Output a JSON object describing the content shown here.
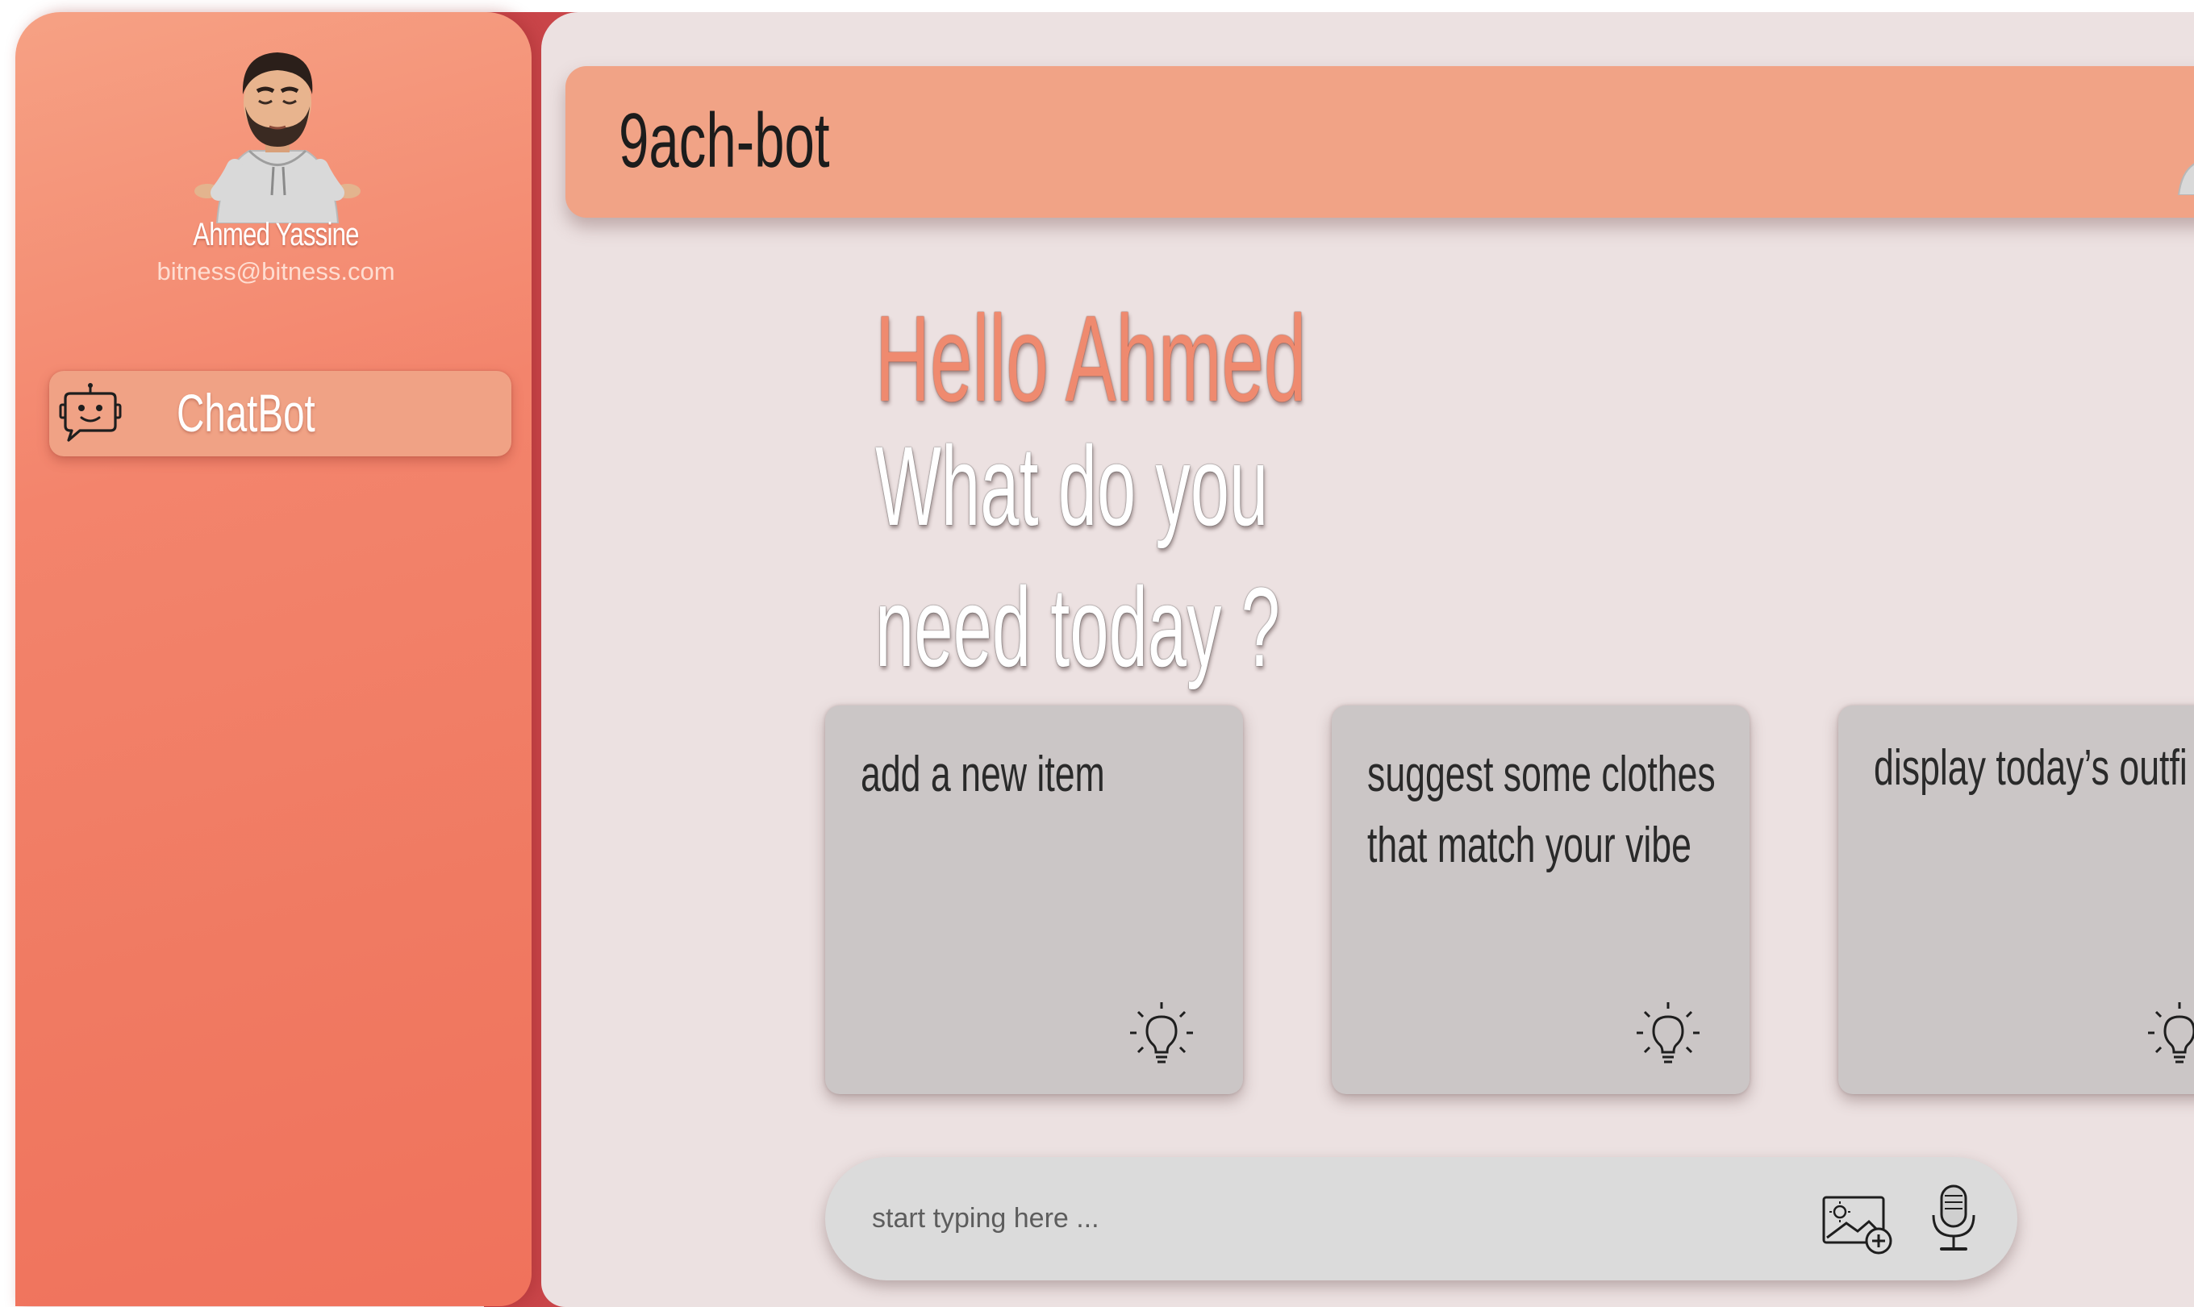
{
  "app": {
    "title": "9ach-bot"
  },
  "user": {
    "name": "Ahmed Yassine",
    "email": "bitness@bitness.com"
  },
  "sidebar": {
    "items": [
      {
        "label": "ChatBot",
        "icon": "chatbot-icon",
        "active": true
      }
    ]
  },
  "greeting": {
    "line1": "Hello Ahmed",
    "line2": "What do you need today ?"
  },
  "suggestions": [
    {
      "text": "add a new item",
      "icon": "lightbulb-icon"
    },
    {
      "text": "suggest some clothes that match your vibe",
      "icon": "lightbulb-icon"
    },
    {
      "text": "display today’s outfi",
      "icon": "lightbulb-icon"
    }
  ],
  "input": {
    "placeholder": "start typing here ...",
    "value": ""
  },
  "colors": {
    "sidebar_accent": "#f3846c",
    "header": "#f1a386",
    "greeting_accent": "#ef8a6f",
    "panel_bg": "#ece1e1",
    "card_bg": "#cbc6c6"
  }
}
